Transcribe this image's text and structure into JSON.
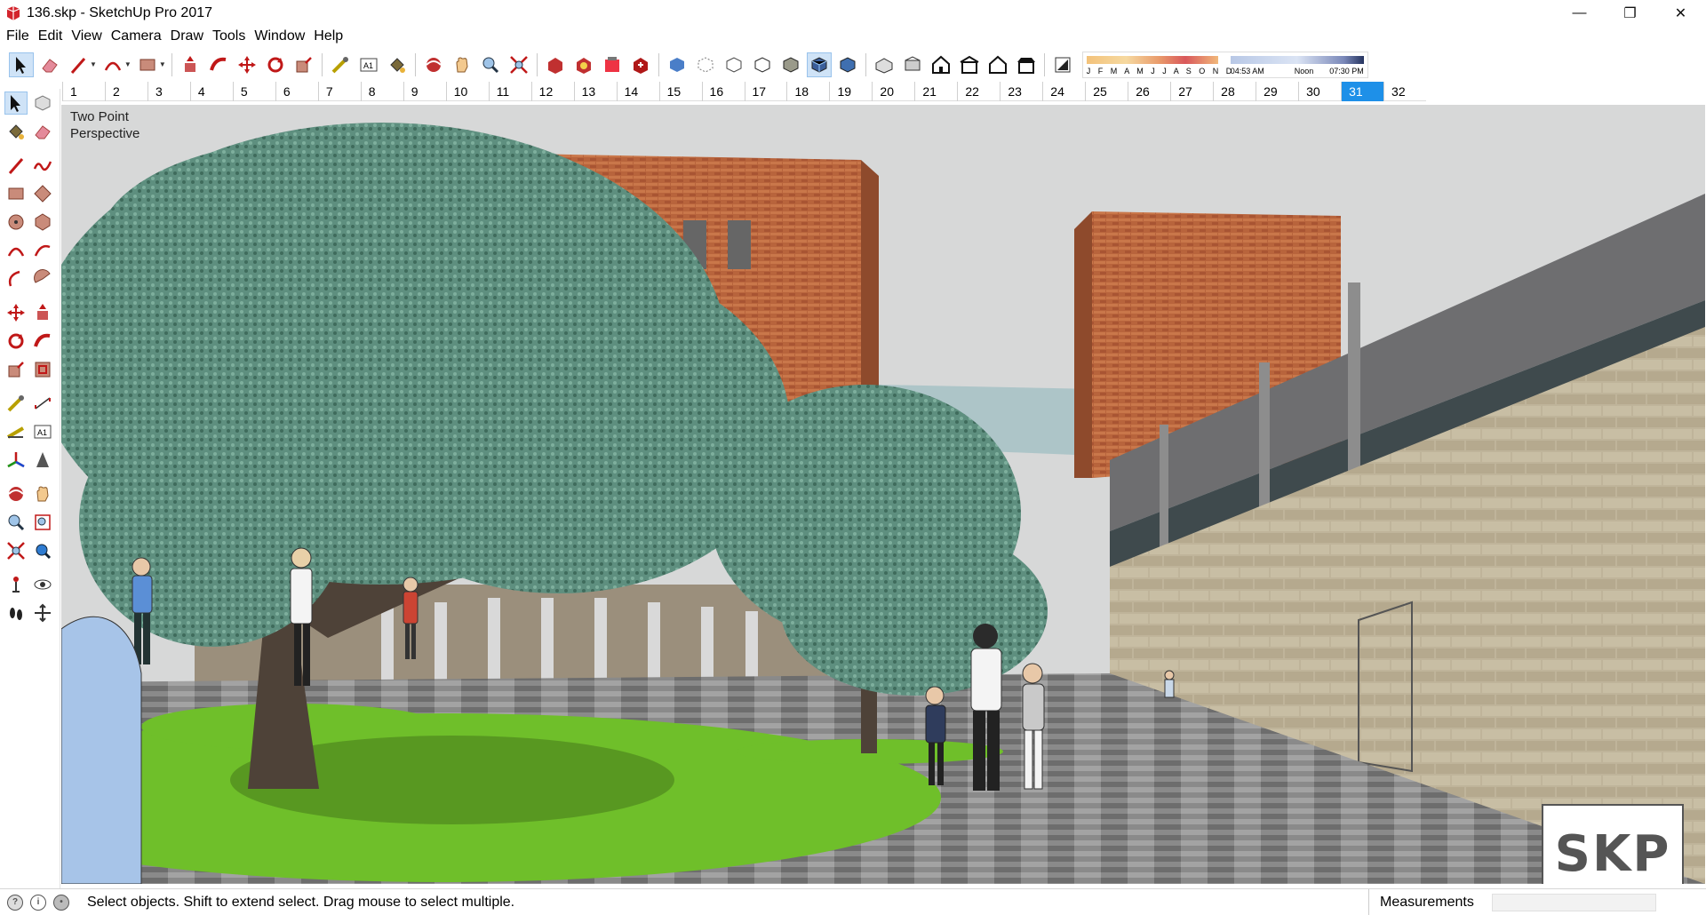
{
  "window": {
    "title": "136.skp - SketchUp Pro 2017",
    "minimize_glyph": "—",
    "maximize_glyph": "❐",
    "close_glyph": "✕"
  },
  "menu": [
    "File",
    "Edit",
    "View",
    "Camera",
    "Draw",
    "Tools",
    "Window",
    "Help"
  ],
  "toolbar": {
    "groups": [
      [
        "select-icon",
        "eraser-icon",
        "line-icon",
        "arc-icon",
        "rectangle-icon"
      ],
      [
        "push-pull-icon",
        "follow-me-icon",
        "move-icon",
        "rotate-icon",
        "scale-icon"
      ],
      [
        "tape-measure-icon",
        "text-icon",
        "paint-bucket-icon"
      ],
      [
        "orbit-icon",
        "pan-icon",
        "zoom-icon",
        "zoom-extents-icon"
      ],
      [
        "3d-warehouse-icon",
        "extension-warehouse-icon",
        "layout-icon",
        "extension-manager-icon"
      ],
      [
        "xray-icon",
        "back-edges-icon",
        "wireframe-icon",
        "hidden-line-icon",
        "shaded-icon",
        "shaded-textures-icon",
        "monochrome-icon"
      ],
      [
        "iso-view-icon",
        "top-view-icon",
        "front-view-icon",
        "right-view-icon",
        "back-view-icon",
        "left-view-icon"
      ],
      [
        "shadows-toggle-icon"
      ]
    ],
    "shadow_months_label": "J F M A M J J A S O N D",
    "shadow_time_start": "04:53 AM",
    "shadow_time_noon": "Noon",
    "shadow_time_end": "07:30 PM"
  },
  "scenes": [
    "1",
    "2",
    "3",
    "4",
    "5",
    "6",
    "7",
    "8",
    "9",
    "10",
    "11",
    "12",
    "13",
    "14",
    "15",
    "16",
    "17",
    "18",
    "19",
    "20",
    "21",
    "22",
    "23",
    "24",
    "25",
    "26",
    "27",
    "28",
    "29",
    "30",
    "31",
    "32"
  ],
  "active_scene": "31",
  "palette": [
    [
      "select-icon",
      "make-component-icon"
    ],
    [
      "paint-bucket-icon",
      "eraser-icon"
    ],
    [
      "line-icon",
      "freehand-icon"
    ],
    [
      "rectangle-icon",
      "rotated-rectangle-icon"
    ],
    [
      "circle-icon",
      "polygon-icon"
    ],
    [
      "arc-icon",
      "two-point-arc-icon"
    ],
    [
      "three-point-arc-icon",
      "pie-icon"
    ],
    [
      "move-icon",
      "push-pull-icon"
    ],
    [
      "rotate-icon",
      "follow-me-icon"
    ],
    [
      "scale-icon",
      "offset-icon"
    ],
    [
      "tape-measure-icon",
      "dimension-icon"
    ],
    [
      "protractor-icon",
      "text-icon"
    ],
    [
      "axes-icon",
      "3d-text-icon"
    ],
    [
      "orbit-icon",
      "pan-icon"
    ],
    [
      "zoom-icon",
      "zoom-window-icon"
    ],
    [
      "zoom-extents-icon",
      "previous-view-icon"
    ],
    [
      "position-camera-icon",
      "look-around-icon"
    ],
    [
      "walk-icon",
      "section-plane-icon"
    ]
  ],
  "viewport": {
    "camera_label_line1": "Two Point",
    "camera_label_line2": "Perspective",
    "logo_text": "SKP",
    "colors": {
      "sky": "#d7d8d8",
      "brick": "#b8643c",
      "stone_wall": "#bfb49a",
      "grass": "#6fbf2a",
      "pavement": "#8a8a8a",
      "tree_foliage": "#5e8f7f",
      "frame_grey": "#6e6e70"
    }
  },
  "status": {
    "message": "Select objects. Shift to extend select. Drag mouse to select multiple.",
    "measurements_label": "Measurements",
    "measurements_value": ""
  }
}
